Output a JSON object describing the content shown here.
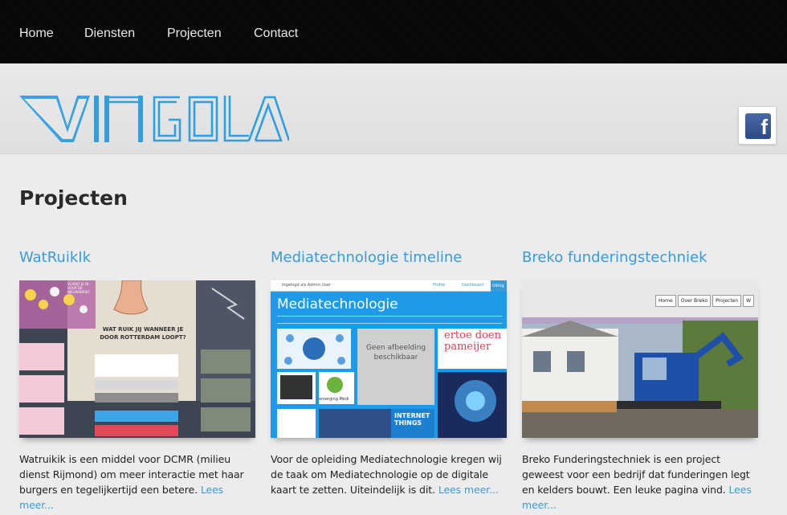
{
  "nav": {
    "items": [
      {
        "label": "Home"
      },
      {
        "label": "Diensten"
      },
      {
        "label": "Projecten"
      },
      {
        "label": "Contact"
      }
    ]
  },
  "brand": {
    "accent": "#3a9ad9",
    "logo_color": "#2f9fe0"
  },
  "social": {
    "facebook_icon": "facebook-icon",
    "facebook_letter": "f"
  },
  "page": {
    "title": "Projecten"
  },
  "projects": [
    {
      "title": "WatRuikIk",
      "description": "Watruikik is een middel voor DCMR (milieu dienst Rijmond) om meer interactie met haar burgers en tegelijkertijd een betere.",
      "more": "Lees meer...",
      "thumb": {
        "heading": "WAT RUIK JIJ WANNEER JE DOOR ROTTERDAM LOOPT?",
        "top_left": "SCHRIJF JE IN VOOR DE NIEUWSBRIEF"
      }
    },
    {
      "title": "Mediatechnologie timeline",
      "description": "Voor de opleiding Mediatechnologie kregen wij de taak om Mediatechnologie op de digitale kaart te zetten. Uiteindelijk is dit.",
      "more": "Lees meer...",
      "thumb": {
        "bar_left": "Ingelogd als Admin User",
        "bar_profile": "Profiel",
        "bar_dashboard": "Dashboard",
        "bar_tab": "Uitlog",
        "heading": "Mediatechnologie",
        "placeholder": "Geen afbeelding beschikbaar",
        "tile_text": "ertoe doen pameijer",
        "tile_text2": "INTERNET THINGS",
        "tile_text3": "emerging Medi"
      }
    },
    {
      "title": "Breko funderingstechniek",
      "description": "Breko Funderingstechniek is een project geweest voor een bedrijf dat funderingen legt en kelders bouwt. Een leuke pagina vind.",
      "more": "Lees meer...",
      "thumb": {
        "menu": [
          "Home",
          "Over Breko",
          "Projecten",
          "W"
        ]
      }
    }
  ]
}
